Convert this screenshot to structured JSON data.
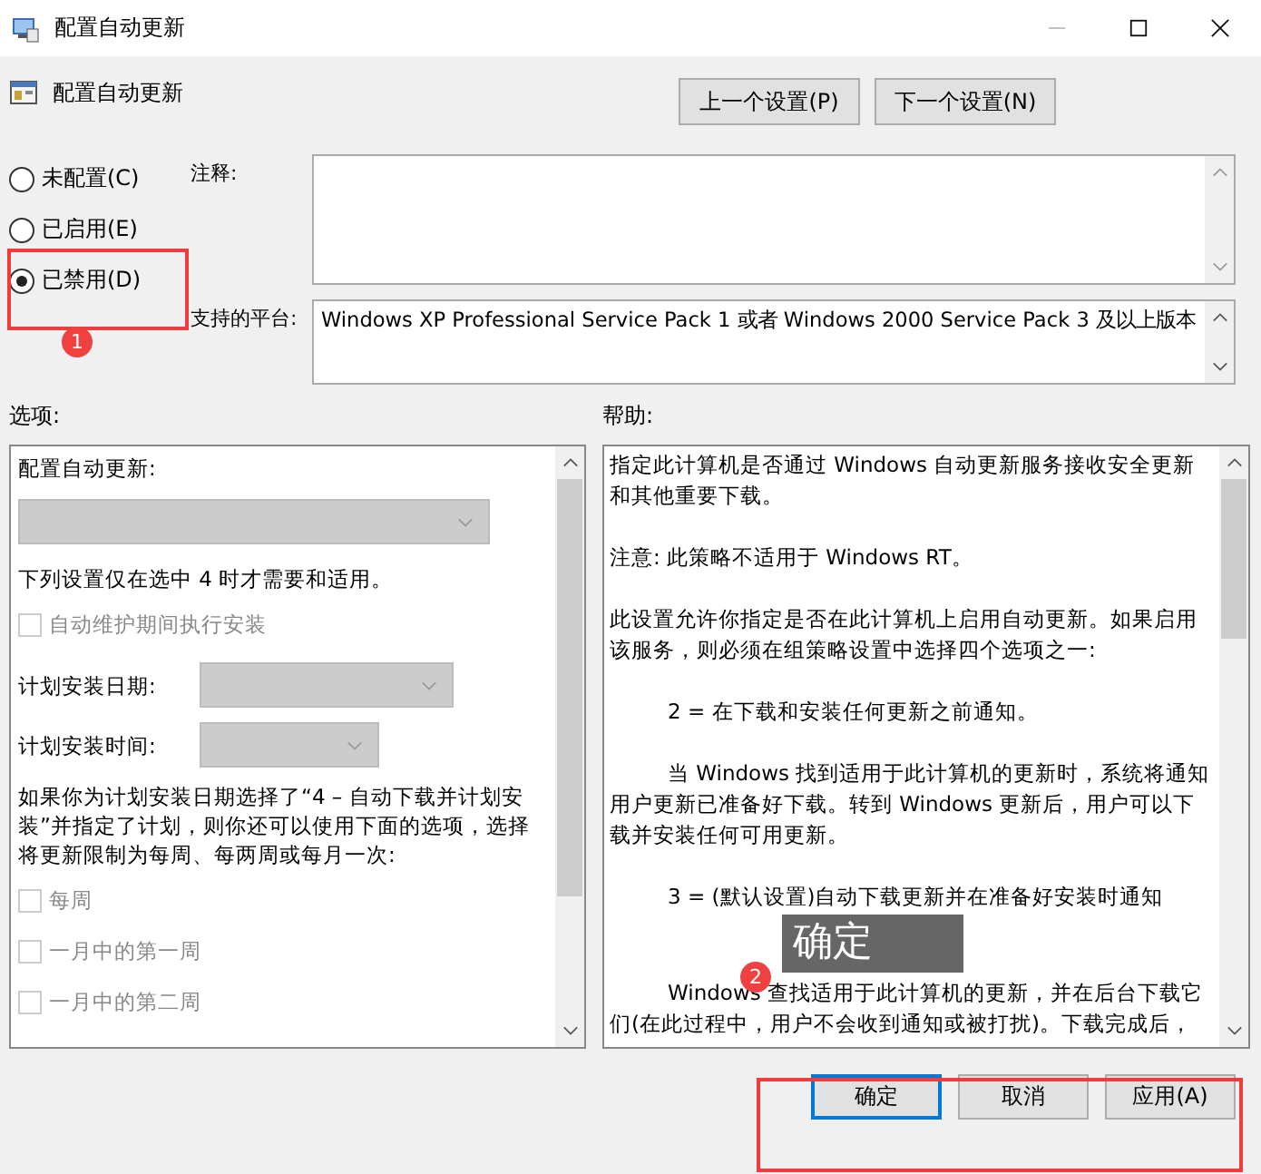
{
  "window": {
    "title": "配置自动更新"
  },
  "header": {
    "title": "配置自动更新"
  },
  "nav_buttons": [
    "上一个设置(P)",
    "下一个设置(N)"
  ],
  "states": [
    {
      "label": "未配置(C)",
      "selected": false
    },
    {
      "label": "已启用(E)",
      "selected": false
    },
    {
      "label": "已禁用(D)",
      "selected": true
    }
  ],
  "comment": {
    "label": "注释:"
  },
  "platform": {
    "label": "支持的平台:",
    "text": "Windows XP Professional Service Pack 1 或者 Windows 2000 Service Pack 3 及以上版本"
  },
  "options": {
    "label": "选项:",
    "items": [
      {
        "kind": "label",
        "text": "配置自动更新:"
      },
      {
        "kind": "dropdown",
        "disabled": true
      },
      {
        "kind": "text",
        "text": "下列设置仅在选中 4 时才需要和适用。"
      },
      {
        "kind": "checkbox",
        "text": "自动维护期间执行安装",
        "checked": false,
        "disabled": true
      },
      {
        "kind": "field",
        "text": "计划安装日期:",
        "disabled": true
      },
      {
        "kind": "field",
        "text": "计划安装时间:",
        "disabled": true
      },
      {
        "kind": "text",
        "text": "如果你为计划安装日期选择了“4 – 自动下载并计划安装”并指定了计划，则你还可以使用下面的选项，选择将更新限制为每周、每两周或每月一次:"
      },
      {
        "kind": "checkbox",
        "text": "每周",
        "checked": false,
        "disabled": true
      },
      {
        "kind": "checkbox",
        "text": "一月中的第一周",
        "checked": false,
        "disabled": true
      },
      {
        "kind": "checkbox",
        "text": "一月中的第二周",
        "checked": false,
        "disabled": true
      }
    ]
  },
  "help": {
    "label": "帮助:",
    "paragraphs": [
      {
        "kind": "plain",
        "text": "指定此计算机是否通过 Windows 自动更新服务接收安全更新和其他重要下载。"
      },
      {
        "kind": "plain",
        "text": "注意: 此策略不适用于 Windows RT。"
      },
      {
        "kind": "plain",
        "text": "此设置允许你指定是否在此计算机上启用自动更新。如果启用该服务，则必须在组策略设置中选择四个选项之一:"
      },
      {
        "kind": "indented",
        "text": "2 = 在下载和安装任何更新之前通知。"
      },
      {
        "kind": "indented",
        "text": "当 Windows 找到适用于此计算机的更新时，系统将通知用户更新已准备好下载。转到 Windows 更新后，用户可以下载并安装任何可用更新。"
      },
      {
        "kind": "indented",
        "text": "3 = (默认设置)自动下载更新并在准备好安装时通知"
      },
      {
        "kind": "indented",
        "text": "Windows 查找适用于此计算机的更新，并在后台下载它们(在此过程中，用户不会收到通知或被打扰)。下载完成后，"
      }
    ]
  },
  "tooltip": {
    "text": "确定"
  },
  "buttons": [
    {
      "label": "确定",
      "focused": true
    },
    {
      "label": "取消",
      "focused": false
    },
    {
      "label": "应用(A)",
      "focused": false
    }
  ],
  "annotations": [
    {
      "text": "1"
    },
    {
      "text": "2"
    }
  ]
}
